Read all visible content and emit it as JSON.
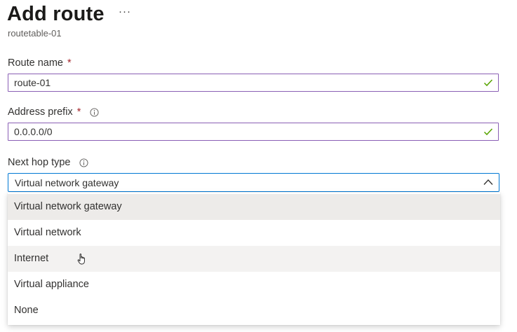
{
  "header": {
    "title": "Add route",
    "more_icon": "more-icon",
    "subtitle": "routetable-01"
  },
  "form": {
    "route_name": {
      "label": "Route name",
      "required_mark": "*",
      "value": "route-01",
      "valid_icon": "check-icon"
    },
    "address_prefix": {
      "label": "Address prefix",
      "required_mark": "*",
      "info_icon": "info-icon",
      "value": "0.0.0.0/0",
      "valid_icon": "check-icon"
    },
    "next_hop_type": {
      "label": "Next hop type",
      "info_icon": "info-icon",
      "selected": "Virtual network gateway",
      "expanded": true,
      "options": [
        "Virtual network gateway",
        "Virtual network",
        "Internet",
        "Virtual appliance",
        "None"
      ],
      "hovered_option": "Internet"
    }
  },
  "colors": {
    "valid_border": "#8a5fb5",
    "focus_border": "#0078d4",
    "check": "#57a300",
    "required": "#a4262c",
    "selected_bg": "#edebe9",
    "hover_bg": "#f3f2f1"
  }
}
